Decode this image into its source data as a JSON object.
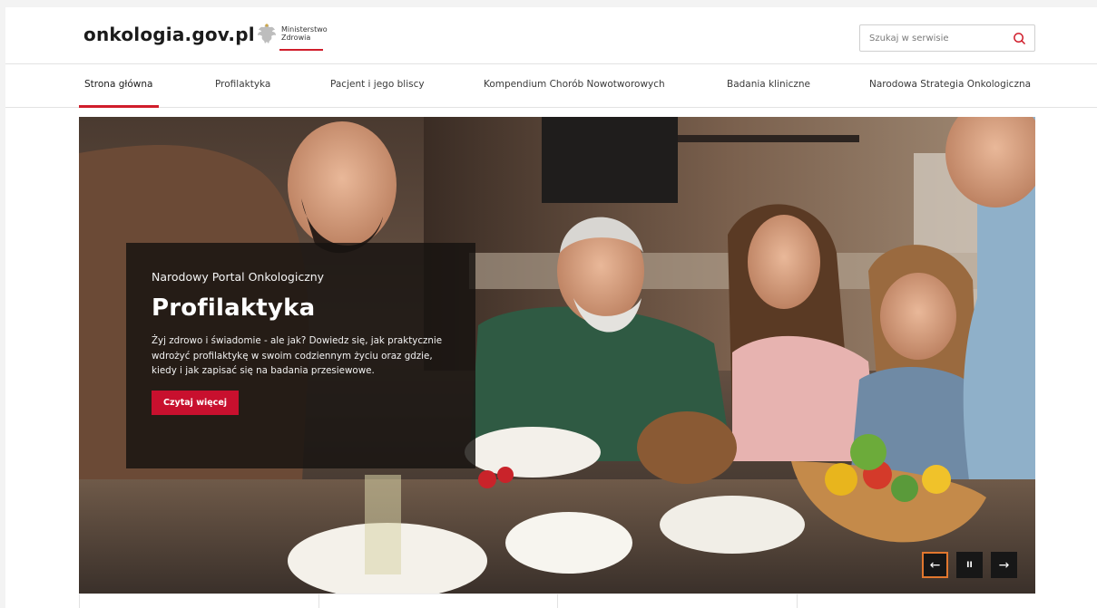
{
  "header": {
    "logo": "onkologia.gov.pl",
    "ministry_line1": "Ministerstwo",
    "ministry_line2": "Zdrowia",
    "search_placeholder": "Szukaj w serwisie"
  },
  "nav": {
    "items": [
      "Strona główna",
      "Profilaktyka",
      "Pacjent i jego bliscy",
      "Kompendium Chorób Nowotworowych",
      "Badania kliniczne",
      "Narodowa Strategia Onkologiczna"
    ],
    "active_index": 0
  },
  "hero": {
    "kicker": "Narodowy Portal Onkologiczny",
    "title": "Profilaktyka",
    "description": "Żyj zdrowo i świadomie - ale jak? Dowiedz się, jak praktycznie wdrożyć profilaktykę w swoim codziennym życiu oraz gdzie, kiedy i jak zapisać się na badania przesiewowe.",
    "button": "Czytaj więcej",
    "controls": {
      "prev": "←",
      "pause": "II",
      "next": "→"
    }
  },
  "colors": {
    "accent": "#d01d2b",
    "button": "#c8102e",
    "control_focus": "#e2772e"
  }
}
